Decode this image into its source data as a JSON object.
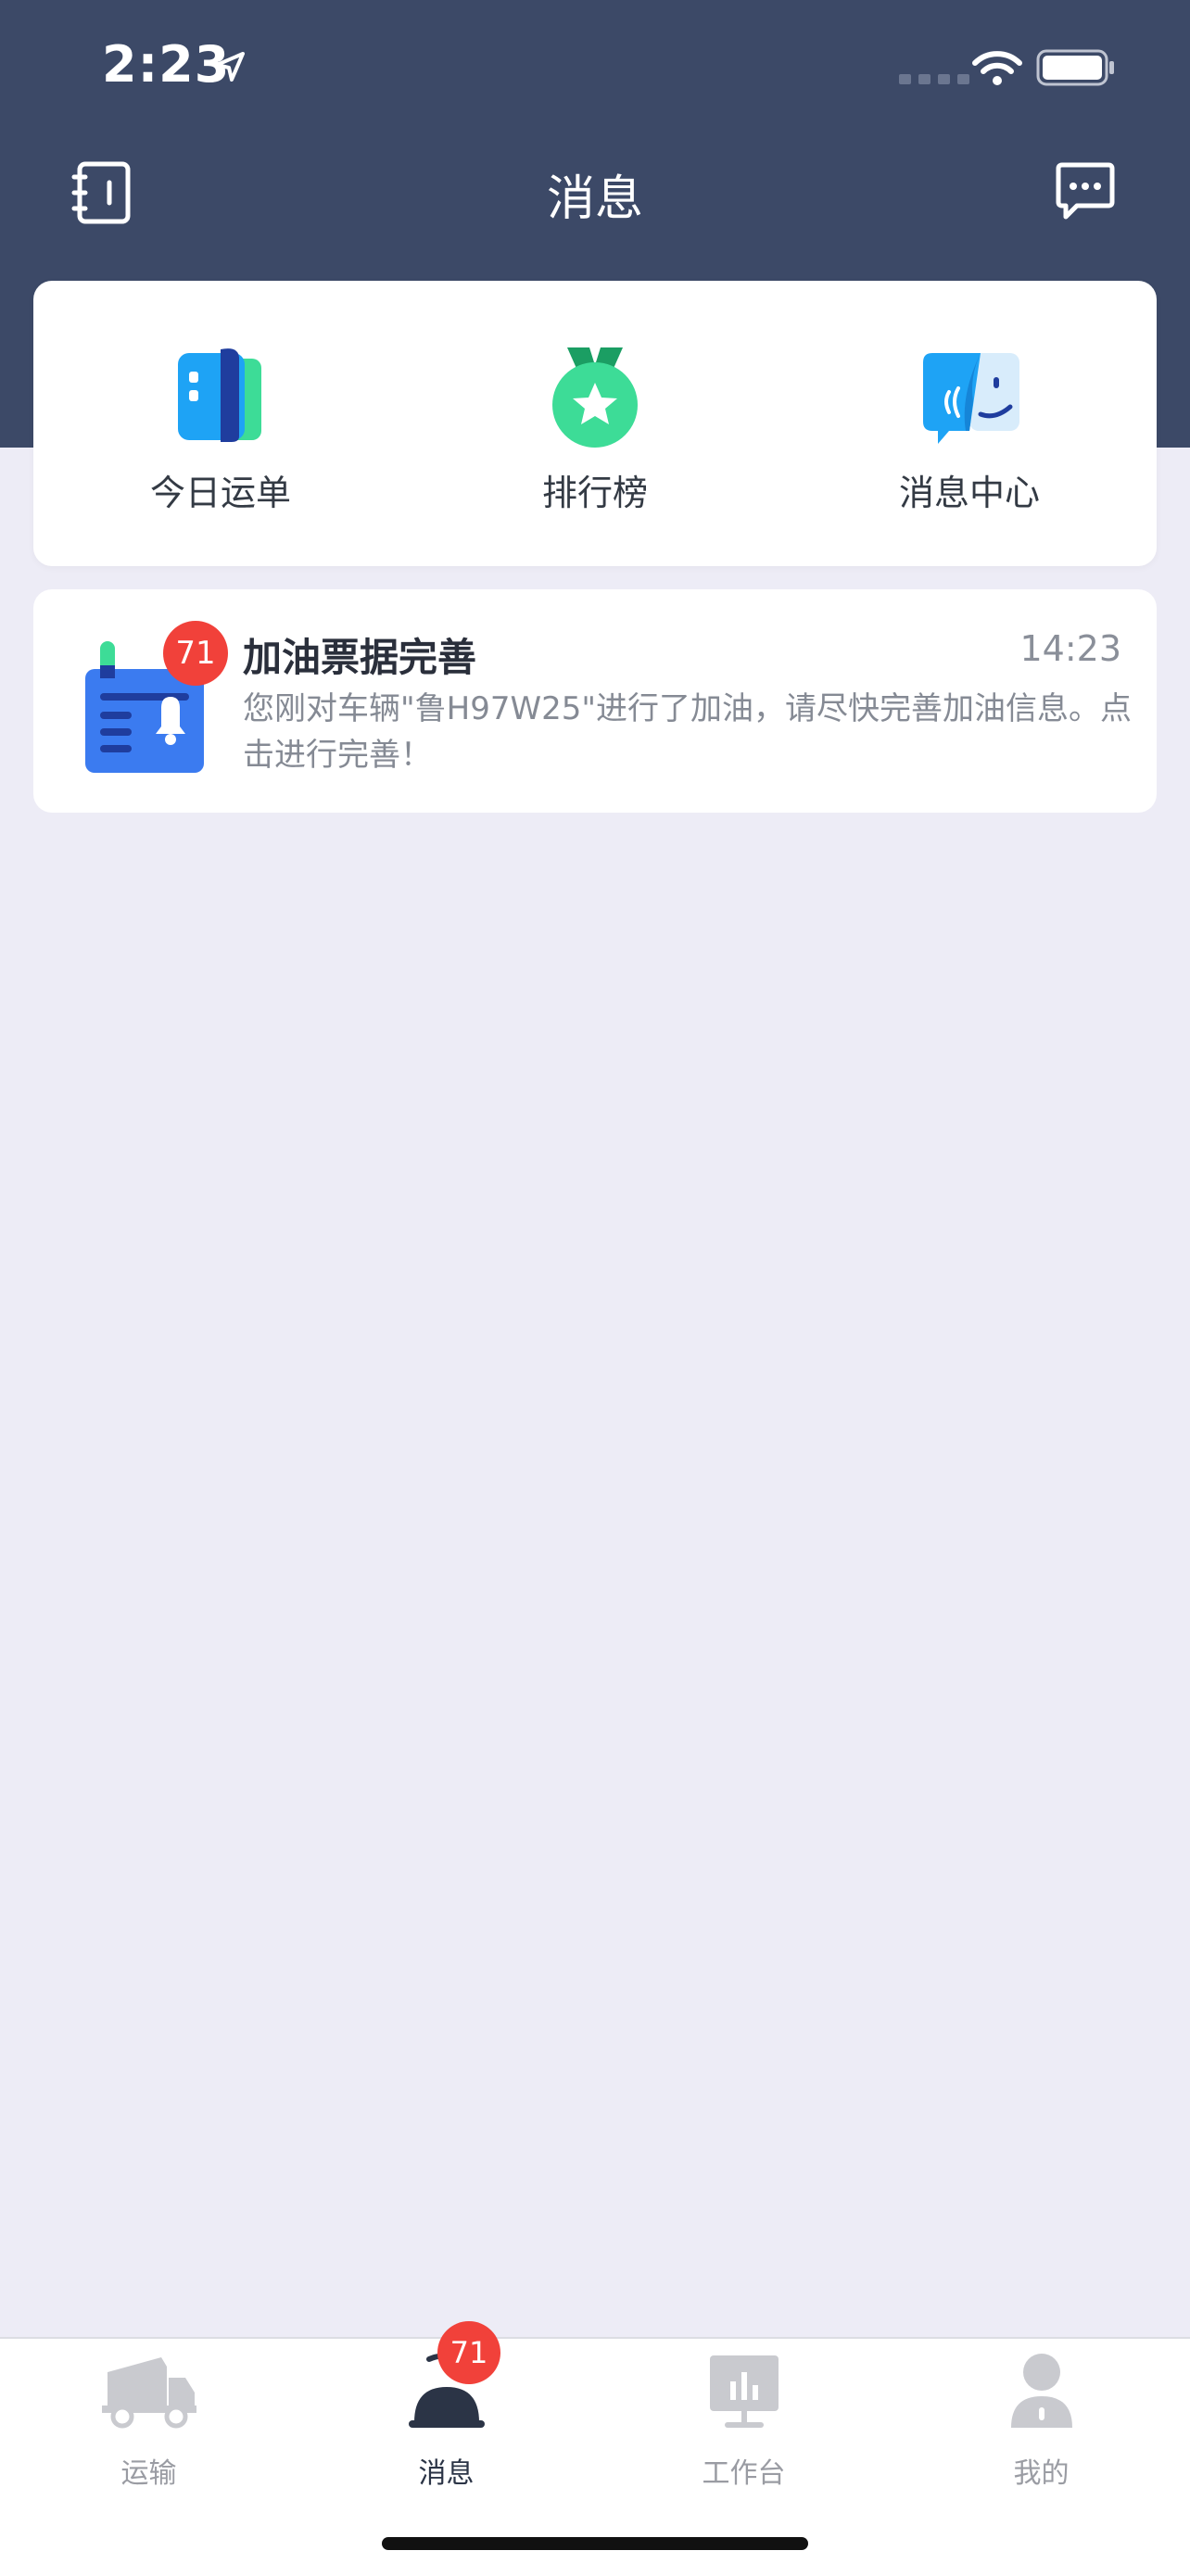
{
  "status_bar": {
    "time": "2:23"
  },
  "nav": {
    "title": "消息"
  },
  "quick_actions": [
    {
      "label": "今日运单",
      "icon": "waybill-icon"
    },
    {
      "label": "排行榜",
      "icon": "medal-icon"
    },
    {
      "label": "消息中心",
      "icon": "message-center-icon"
    }
  ],
  "messages": [
    {
      "title": "加油票据完善",
      "time": "14:23",
      "body": "您刚对车辆\"鲁H97W25\"进行了加油，请尽快完善加油信息。点击进行完善！",
      "badge": "71",
      "icon": "notice-bell-icon"
    }
  ],
  "tabs": [
    {
      "label": "运输",
      "icon": "truck-icon",
      "active": false
    },
    {
      "label": "消息",
      "icon": "bell-icon",
      "active": true,
      "badge": "71"
    },
    {
      "label": "工作台",
      "icon": "dashboard-icon",
      "active": false
    },
    {
      "label": "我的",
      "icon": "person-icon",
      "active": false
    }
  ],
  "colors": {
    "header": "#3c4967",
    "background": "#edecf6",
    "badge": "#f1413a",
    "accent_green": "#3ddc97",
    "accent_blue": "#2a86f0"
  }
}
